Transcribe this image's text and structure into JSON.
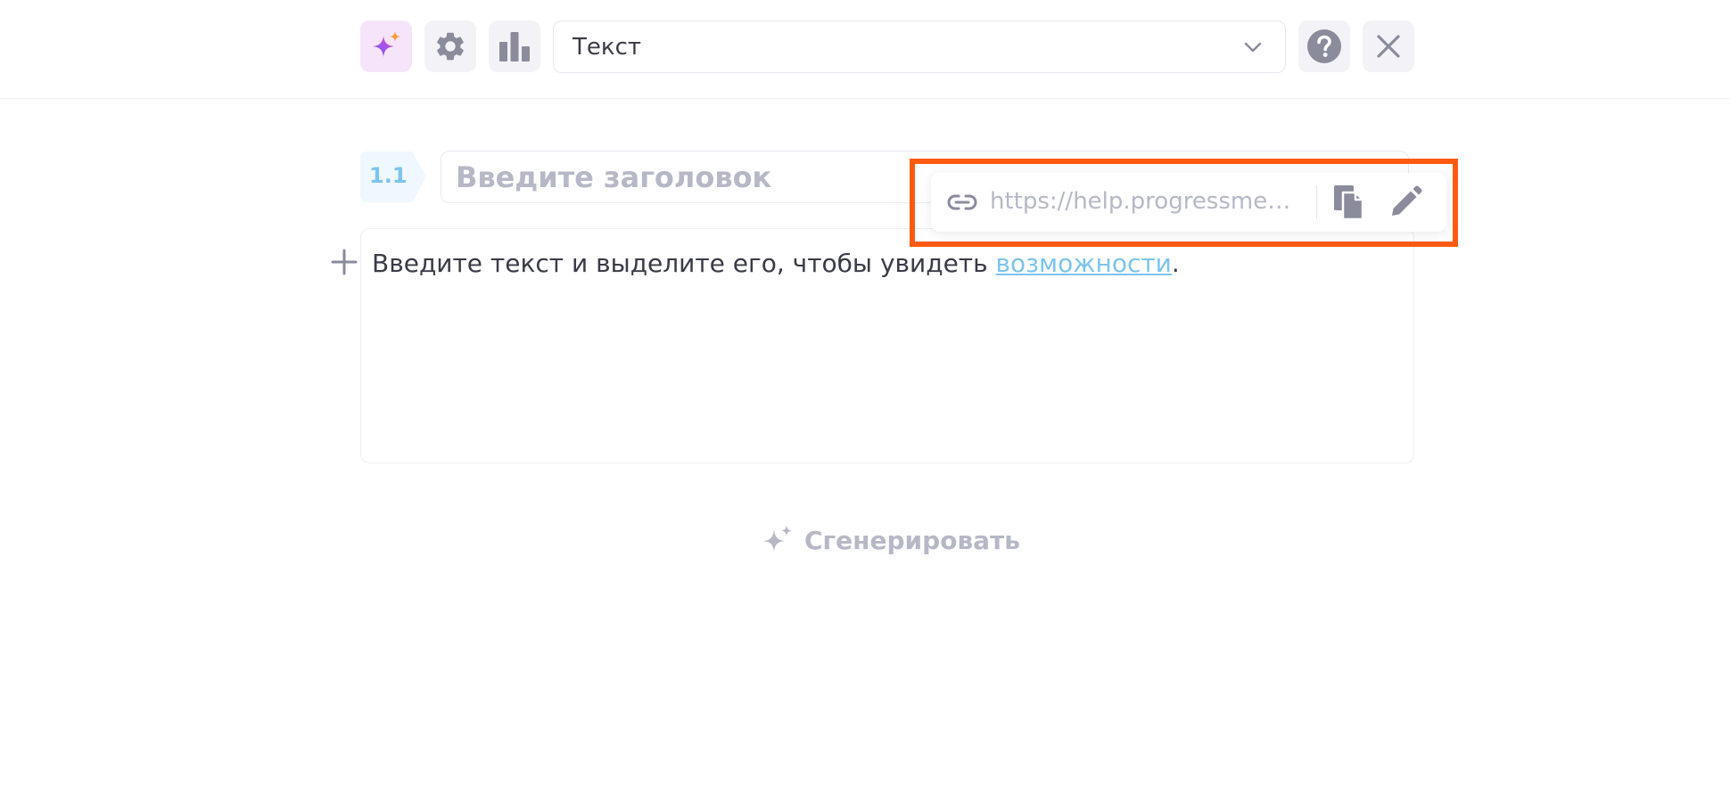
{
  "toolbar": {
    "type_select": {
      "value": "Текст"
    }
  },
  "heading": {
    "number": "1.1",
    "placeholder": "Введите заголовок"
  },
  "editor": {
    "text_before": "Введите текст и выделите его, чтобы увидеть ",
    "link_text": "возможности",
    "text_after": "."
  },
  "link_popover": {
    "url": "https://help.progressme…"
  },
  "generate": {
    "label": "Сгенерировать"
  },
  "colors": {
    "accent_blue": "#7cc4ef",
    "highlight_orange": "#ff5a12",
    "icon_gray": "#8a8b9b",
    "placeholder_gray": "#b6b8c6"
  }
}
